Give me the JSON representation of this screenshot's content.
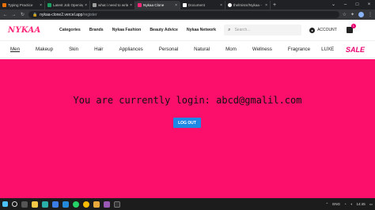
{
  "browser": {
    "tabs": [
      {
        "title": "Typing Practice",
        "color": "#e8710a",
        "active": false
      },
      {
        "title": "Latest Job Opening",
        "color": "#1aa260",
        "active": false
      },
      {
        "title": "what i need to write",
        "color": "#9e9e9e",
        "active": false
      },
      {
        "title": "Nykaa Clone",
        "color": "#fc2779",
        "active": true
      },
      {
        "title": "Document",
        "color": "#ffffff",
        "active": false
      },
      {
        "title": "thelmisnr/Nykaa -",
        "color": "#ffffff",
        "active": false
      }
    ],
    "url_host": "nykaa-clone2.vercel.app",
    "url_path": "/register"
  },
  "header": {
    "logo": "NYKAA",
    "nav": [
      "Categories",
      "Brands",
      "Nykaa Fashion",
      "Beauty Advice",
      "Nykaa Network"
    ],
    "search_placeholder": "Search...",
    "account_label": "ACCOUNT",
    "cart_count": "1"
  },
  "categories": [
    "Men",
    "Makeup",
    "Skin",
    "Hair",
    "Appliances",
    "Personal",
    "Natural",
    "Mom",
    "Wellness",
    "Fragrance",
    "LUXE"
  ],
  "sale_label": "SALE",
  "main": {
    "message": "You are currently login: abcd@gmalil.com",
    "logout_label": "LOG OUT"
  },
  "taskbar": {
    "lang": "ENG",
    "time": "14:45"
  },
  "colors": {
    "brand": "#fc2779",
    "hero_bg": "#fc0f6b",
    "button": "#1e88e5"
  }
}
